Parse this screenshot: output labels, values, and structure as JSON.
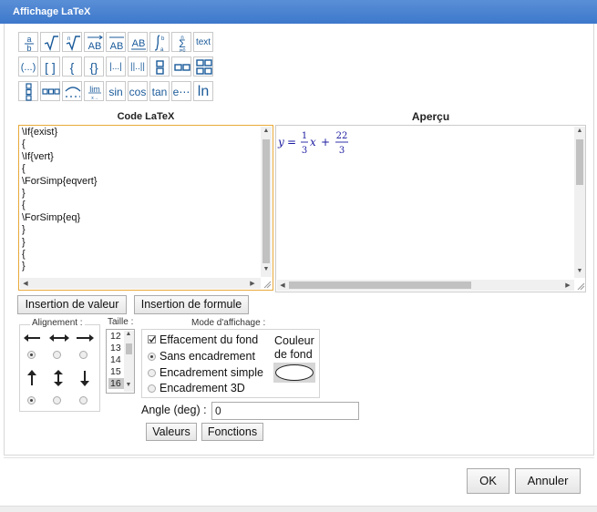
{
  "window": {
    "title": "Affichage LaTeX"
  },
  "toolbar": {
    "row1": [
      "a/b",
      "√",
      "ⁿ√",
      "AB→",
      "AB‾",
      "AB_",
      "∫ab",
      "Σ",
      "text"
    ],
    "row2": [
      "(...)",
      "[ ]",
      "{ }",
      "{ }",
      "|...|",
      "||..||",
      "matrix-2x1",
      "matrix-1x2",
      "matrix-2x2"
    ],
    "row3": [
      "matrix-3x1",
      "matrix-1x3",
      "arc",
      "lim",
      "sin",
      "cos",
      "tan",
      "e⋯",
      "ln"
    ],
    "labels": {
      "text": "text",
      "paren": "(...)",
      "brack": "[ ]",
      "brace": "{",
      "braces": "{}",
      "abs": "|...|",
      "norm": "||..||",
      "lim": "lim",
      "limsub": "x→",
      "sin": "sin",
      "cos": "cos",
      "tan": "tan",
      "exp": "e⋯",
      "ln": "ln"
    }
  },
  "code": {
    "title": "Code LaTeX",
    "lines": [
      "\\If{exist}",
      "{",
      "\\If{vert}",
      "{",
      "\\ForSimp{eqvert}",
      "}",
      "{",
      "\\ForSimp{eq}",
      "}",
      "}",
      "{",
      "}"
    ]
  },
  "preview": {
    "title": "Aperçu",
    "formula": {
      "lhs": "y",
      "eq": "=",
      "num1": "1",
      "den1": "3",
      "var": "x",
      "plus": "+",
      "num2": "22",
      "den2": "3"
    }
  },
  "buttons": {
    "insert_value": "Insertion de valeur",
    "insert_formula": "Insertion de formule",
    "values": "Valeurs",
    "functions": "Fonctions",
    "ok": "OK",
    "cancel": "Annuler"
  },
  "alignment": {
    "legend": "Alignement :"
  },
  "size": {
    "legend": "Taille :",
    "options": [
      "12",
      "13",
      "14",
      "15",
      "16"
    ],
    "selected": "16"
  },
  "display_mode": {
    "legend": "Mode d'affichage :",
    "clear_bg": "Effacement du fond",
    "no_frame": "Sans encadrement",
    "simple_frame": "Encadrement simple",
    "frame_3d": "Encadrement 3D",
    "bg_color_label1": "Couleur",
    "bg_color_label2": "de fond",
    "clear_bg_checked": true,
    "selected": "Sans encadrement"
  },
  "angle": {
    "label": "Angle (deg) :",
    "value": "0"
  },
  "colors": {
    "title_bar": "#4683d2",
    "accent": "#1a5a9a",
    "code_border": "#e8a93a",
    "formula": "#1a1aa0"
  }
}
